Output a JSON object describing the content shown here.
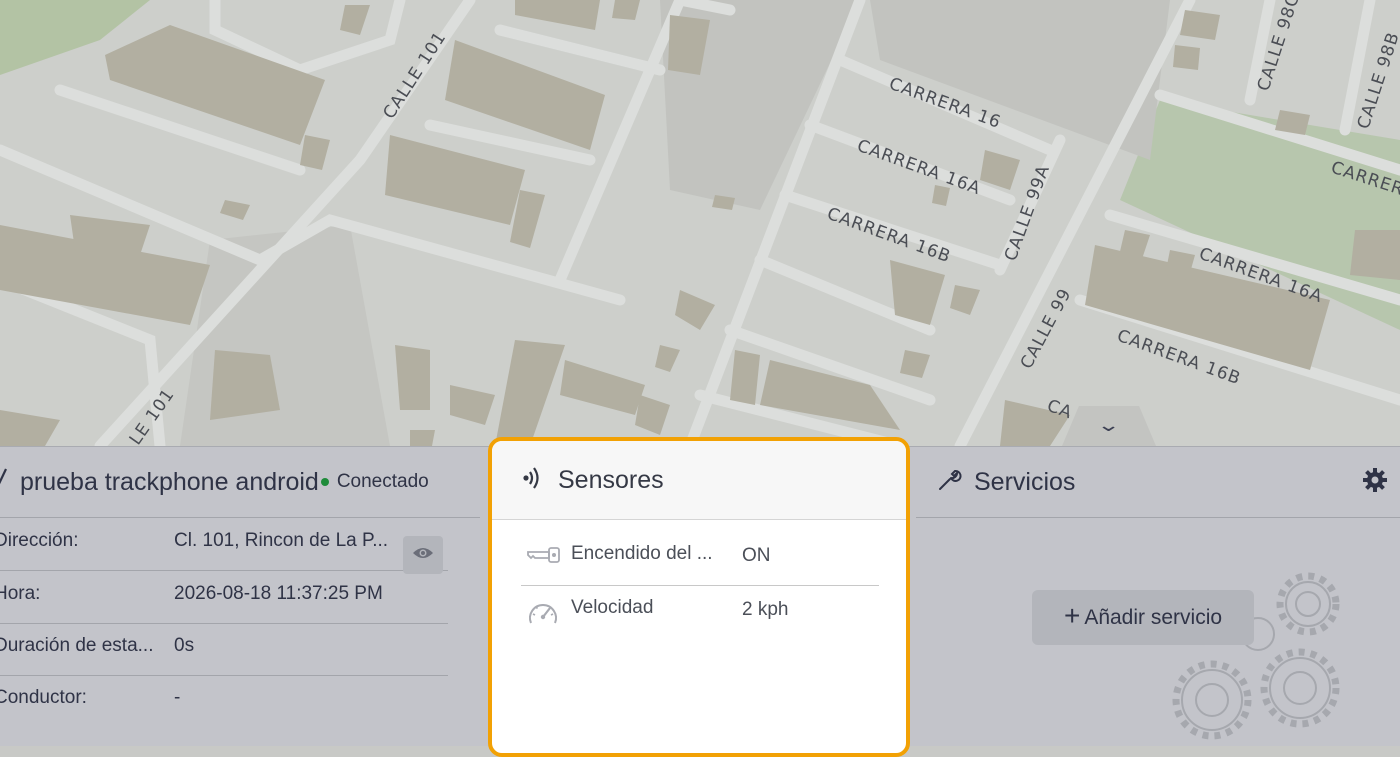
{
  "map": {
    "street_labels": [
      "CALLE 101",
      "LE 101",
      "CARRERA 16",
      "CARRERA 16A",
      "CARRERA 16B",
      "CALLE 99A",
      "CALLE 99",
      "CARRERA 16A",
      "CARRERA 16B",
      "CALLE 98C",
      "CALLE 98B",
      "CARRER",
      "CA"
    ],
    "collapse_icon": "chevron-down-icon"
  },
  "device": {
    "name": "prueba trackphone android",
    "status": "Conectado",
    "status_color": "#1e8b3a",
    "rows": [
      {
        "label": "Dirección:",
        "value": "Cl. 101, Rincon de La P..."
      },
      {
        "label": "Hora:",
        "value": "2026-08-18 11:37:25 PM"
      },
      {
        "label": "Duración de esta...",
        "value": "0s"
      },
      {
        "label": "Conductor:",
        "value": "-"
      }
    ],
    "view_icon": "eye-icon"
  },
  "sensors": {
    "title": "Sensores",
    "highlight_color": "#f2a104",
    "items": [
      {
        "label": "Encendido del ...",
        "value": "ON",
        "icon": "key-icon"
      },
      {
        "label": "Velocidad",
        "value": "2 kph",
        "icon": "speedometer-icon"
      }
    ]
  },
  "services": {
    "title": "Servicios",
    "add_label": "Añadir servicio",
    "add_symbol": "+"
  }
}
